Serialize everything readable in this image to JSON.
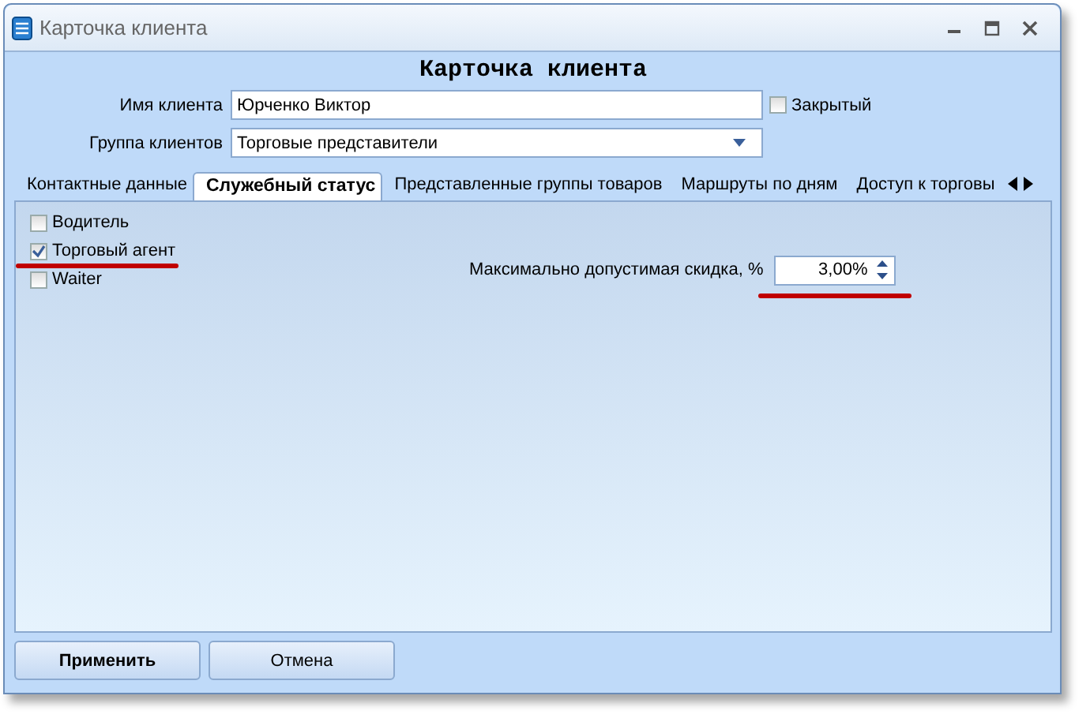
{
  "window": {
    "title": "Карточка клиента"
  },
  "heading": "Карточка клиента",
  "fields": [
    {
      "label": "Имя клиента",
      "value": "Юрченко Виктор",
      "kind": "text"
    },
    {
      "label": "Группа клиентов",
      "value": "Торговые представители",
      "kind": "dropdown"
    }
  ],
  "closed_checkbox": {
    "label": "Закрытый",
    "checked": false
  },
  "tabs": [
    {
      "label": "Контактные данные",
      "selected": false
    },
    {
      "label": "Служебный статус",
      "selected": true
    },
    {
      "label": "Представленные группы товаров",
      "selected": false
    },
    {
      "label": "Маршруты по дням",
      "selected": false
    },
    {
      "label": "Доступ к торговы",
      "selected": false
    }
  ],
  "roles": [
    {
      "label": "Водитель",
      "checked": false,
      "underlined": false
    },
    {
      "label": "Торговый агент",
      "checked": true,
      "underlined": true
    },
    {
      "label": "Waiter",
      "checked": false,
      "underlined": false
    }
  ],
  "discount": {
    "label": "Максимально допустимая скидка, %",
    "value": "3,00%",
    "underlined": true
  },
  "buttons": [
    {
      "label": "Применить",
      "primary": true
    },
    {
      "label": "Отмена",
      "primary": false
    }
  ]
}
